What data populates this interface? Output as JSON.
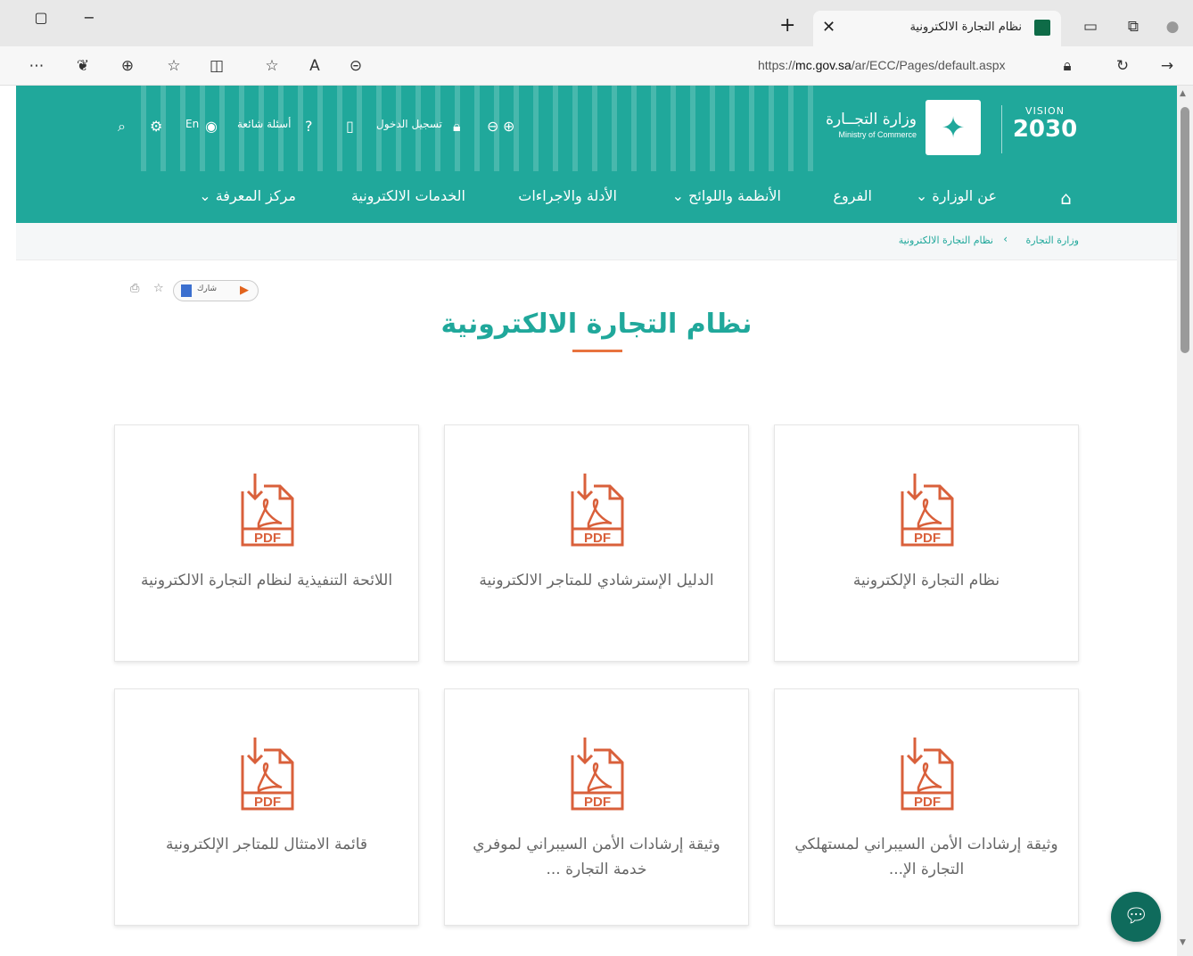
{
  "browser": {
    "tab_title": "نظام التجارة الالكترونية",
    "url_prefix": "https://",
    "url_host": "mc.gov.sa",
    "url_path": "/ar/ECC/Pages/default.aspx",
    "icons": [
      "window-icon",
      "minimize-icon",
      "new-tab-icon",
      "close-tab-icon",
      "tab-layout-icon",
      "collections-icon",
      "profile-icon",
      "more-icon",
      "extensions-icon",
      "tab-actions-icon",
      "favorites-icon",
      "split-screen-icon",
      "star-icon",
      "read-aloud-icon",
      "zoom-icon",
      "lock-icon",
      "refresh-icon",
      "forward-icon"
    ]
  },
  "header": {
    "vision_label": "VISION",
    "vision_year": "2030",
    "ministry_ar": "وزارة التجــارة",
    "ministry_en": "Ministry of Commerce",
    "utility": {
      "login": "تسجيل الدخول",
      "faq": "أسئلة شائعة",
      "lang": "En"
    },
    "nav": [
      {
        "label": "عن الوزارة ⌄"
      },
      {
        "label": "الفروع"
      },
      {
        "label": "الأنظمة واللوائح ⌄"
      },
      {
        "label": "الأدلة والاجراءات"
      },
      {
        "label": "الخدمات الالكترونية"
      },
      {
        "label": "مركز المعرفة ⌄"
      }
    ]
  },
  "breadcrumb": {
    "home": "وزارة التجارة",
    "separator": "‹",
    "current": "نظام التجارة الالكترونية"
  },
  "share": {
    "label": "شارك"
  },
  "page": {
    "title": "نظام التجارة الالكترونية"
  },
  "cards": [
    {
      "title": "نظام التجارة الإلكترونية",
      "icon": "pdf-icon"
    },
    {
      "title": "الدليل الإسترشادي للمتاجر الالكترونية",
      "icon": "pdf-icon"
    },
    {
      "title": "اللائحة التنفيذية لنظام التجارة الالكترونية",
      "icon": "pdf-icon"
    },
    {
      "title": "وثيقة إرشادات الأمن السيبراني لمستهلكي التجارة الإ...",
      "icon": "pdf-icon"
    },
    {
      "title": "وثيقة إرشادات الأمن السيبراني لموفري خدمة التجارة ...",
      "icon": "pdf-icon"
    },
    {
      "title": "قائمة الامتثال للمتاجر الإلكترونية",
      "icon": "pdf-icon"
    }
  ],
  "colors": {
    "brand": "#20a89b",
    "accent": "#e8733f",
    "pdf": "#d9603b"
  }
}
